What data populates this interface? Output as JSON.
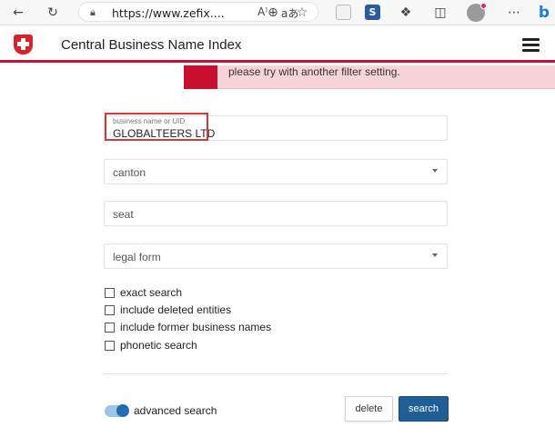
{
  "browser": {
    "url": "https://www.zefix....",
    "read_aloud": "A⁾",
    "translate": "aあ"
  },
  "header": {
    "title": "Central Business Name Index"
  },
  "alert": {
    "message": "please try with another filter setting."
  },
  "form": {
    "name_label": "business name or UID",
    "name_value": "GLOBALTEERS LTD",
    "canton_label": "canton",
    "seat_label": "seat",
    "legal_form_label": "legal form",
    "checkboxes": [
      {
        "label": "exact search",
        "checked": false
      },
      {
        "label": "include deleted entities",
        "checked": false
      },
      {
        "label": "include former business names",
        "checked": false
      },
      {
        "label": "phonetic search",
        "checked": false
      }
    ],
    "advanced_search_label": "advanced search",
    "advanced_search_on": true,
    "delete_label": "delete",
    "search_label": "search"
  },
  "colors": {
    "accent_red": "#c8102e",
    "button_blue": "#1f5f95",
    "alert_bg": "#f6d4d8"
  }
}
